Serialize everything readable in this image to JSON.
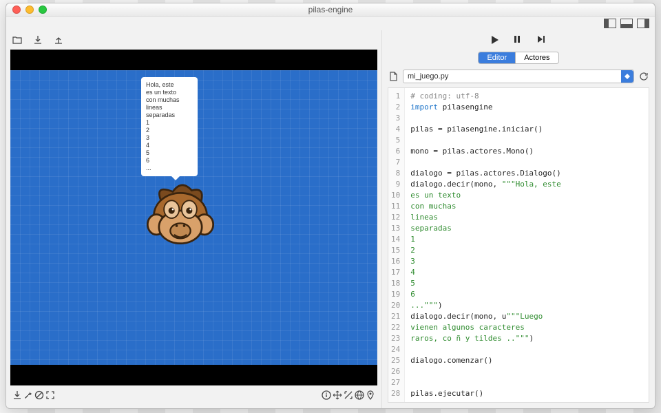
{
  "window": {
    "title": "pilas-engine"
  },
  "tabs": {
    "editor": "Editor",
    "actores": "Actores"
  },
  "file": {
    "name": "mi_juego.py"
  },
  "balloon": "Hola, este\nes un texto\ncon muchas\nlineas\nseparadas\n1\n2\n3\n4\n5\n6\n...",
  "code": {
    "lines": [
      {
        "n": 1,
        "t": [
          {
            "c": "comment",
            "v": "# coding: utf-8"
          }
        ]
      },
      {
        "n": 2,
        "t": [
          {
            "c": "kw",
            "v": "import"
          },
          {
            "c": "",
            "v": " pilasengine"
          }
        ]
      },
      {
        "n": 3,
        "t": []
      },
      {
        "n": 4,
        "t": [
          {
            "c": "",
            "v": "pilas = pilasengine.iniciar()"
          }
        ]
      },
      {
        "n": 5,
        "t": []
      },
      {
        "n": 6,
        "t": [
          {
            "c": "",
            "v": "mono = pilas.actores.Mono()"
          }
        ]
      },
      {
        "n": 7,
        "t": []
      },
      {
        "n": 8,
        "t": [
          {
            "c": "",
            "v": "dialogo = pilas.actores.Dialogo()"
          }
        ]
      },
      {
        "n": 9,
        "t": [
          {
            "c": "",
            "v": "dialogo.decir(mono, "
          },
          {
            "c": "str",
            "v": "\"\"\"Hola, este"
          }
        ]
      },
      {
        "n": 10,
        "t": [
          {
            "c": "str",
            "v": "es un texto"
          }
        ]
      },
      {
        "n": 11,
        "t": [
          {
            "c": "str",
            "v": "con muchas"
          }
        ]
      },
      {
        "n": 12,
        "t": [
          {
            "c": "str",
            "v": "lineas"
          }
        ]
      },
      {
        "n": 13,
        "t": [
          {
            "c": "str",
            "v": "separadas"
          }
        ]
      },
      {
        "n": 14,
        "t": [
          {
            "c": "str",
            "v": "1"
          }
        ]
      },
      {
        "n": 15,
        "t": [
          {
            "c": "str",
            "v": "2"
          }
        ]
      },
      {
        "n": 16,
        "t": [
          {
            "c": "str",
            "v": "3"
          }
        ]
      },
      {
        "n": 17,
        "t": [
          {
            "c": "str",
            "v": "4"
          }
        ]
      },
      {
        "n": 18,
        "t": [
          {
            "c": "str",
            "v": "5"
          }
        ]
      },
      {
        "n": 19,
        "t": [
          {
            "c": "str",
            "v": "6"
          }
        ]
      },
      {
        "n": 20,
        "t": [
          {
            "c": "str",
            "v": "...\"\"\""
          },
          {
            "c": "",
            "v": ")"
          }
        ]
      },
      {
        "n": 21,
        "t": [
          {
            "c": "",
            "v": "dialogo.decir(mono, u"
          },
          {
            "c": "str",
            "v": "\"\"\"Luego"
          }
        ]
      },
      {
        "n": 22,
        "t": [
          {
            "c": "str",
            "v": "vienen algunos caracteres"
          }
        ]
      },
      {
        "n": 23,
        "t": [
          {
            "c": "str",
            "v": "raros, co ñ y tildes ..\"\"\""
          },
          {
            "c": "",
            "v": ")"
          }
        ]
      },
      {
        "n": 24,
        "t": []
      },
      {
        "n": 25,
        "t": [
          {
            "c": "",
            "v": "dialogo.comenzar()"
          }
        ]
      },
      {
        "n": 26,
        "t": []
      },
      {
        "n": 27,
        "t": []
      },
      {
        "n": 28,
        "t": [
          {
            "c": "",
            "v": "pilas.ejecutar()"
          }
        ]
      }
    ]
  }
}
